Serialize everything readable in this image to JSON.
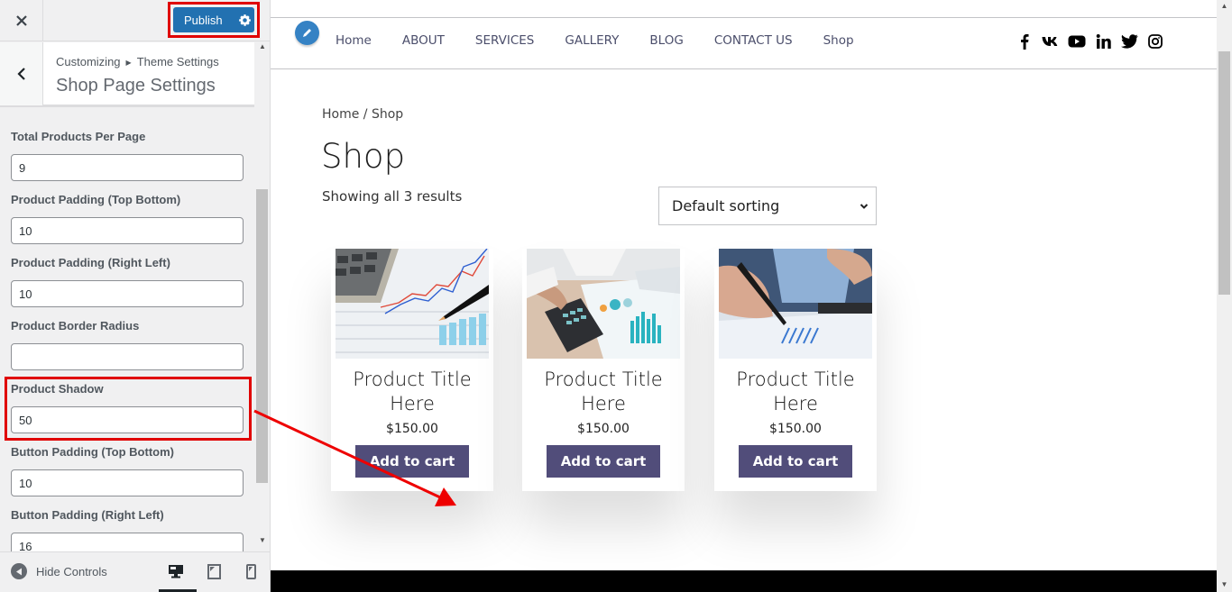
{
  "customizer": {
    "close_icon": "close-icon",
    "publish_label": "Publish",
    "publish_color": "#2271b1",
    "breadcrumb": [
      "Customizing",
      "Theme Settings"
    ],
    "panel_title": "Shop Page Settings",
    "controls": [
      {
        "label": "Total Products Per Page",
        "value": "9"
      },
      {
        "label": "Product Padding (Top Bottom)",
        "value": "10"
      },
      {
        "label": "Product Padding (Right Left)",
        "value": "10"
      },
      {
        "label": "Product Border Radius",
        "value": ""
      },
      {
        "label": "Product Shadow",
        "value": "50"
      },
      {
        "label": "Button Padding (Top Bottom)",
        "value": "10"
      },
      {
        "label": "Button Padding (Right Left)",
        "value": "16"
      }
    ],
    "footer": {
      "hide_controls_label": "Hide Controls",
      "devices": [
        "desktop",
        "tablet",
        "mobile"
      ],
      "active_device": "desktop"
    }
  },
  "site": {
    "nav": [
      "Home",
      "ABOUT",
      "SERVICES",
      "GALLERY",
      "BLOG",
      "CONTACT US",
      "Shop"
    ],
    "socials": [
      "facebook-icon",
      "vk-icon",
      "youtube-icon",
      "linkedin-icon",
      "twitter-icon",
      "instagram-icon"
    ],
    "breadcrumb": "Home / Shop",
    "page_title": "Shop",
    "result_count": "Showing all 3 results",
    "sorting": "Default sorting",
    "accent_color": "#514d7a",
    "products": [
      {
        "title": "Product Title Here",
        "price": "$150.00",
        "button": "Add to cart",
        "image": "calculator-charts-photo"
      },
      {
        "title": "Product Title Here",
        "price": "$150.00",
        "button": "Add to cart",
        "image": "hands-calculator-reports-photo"
      },
      {
        "title": "Product Title Here",
        "price": "$150.00",
        "button": "Add to cart",
        "image": "pen-pointing-chart-photo"
      }
    ]
  },
  "annotations": {
    "highlight_color": "#e00000",
    "highlighted": [
      "publish-button",
      "product-shadow-control"
    ]
  }
}
